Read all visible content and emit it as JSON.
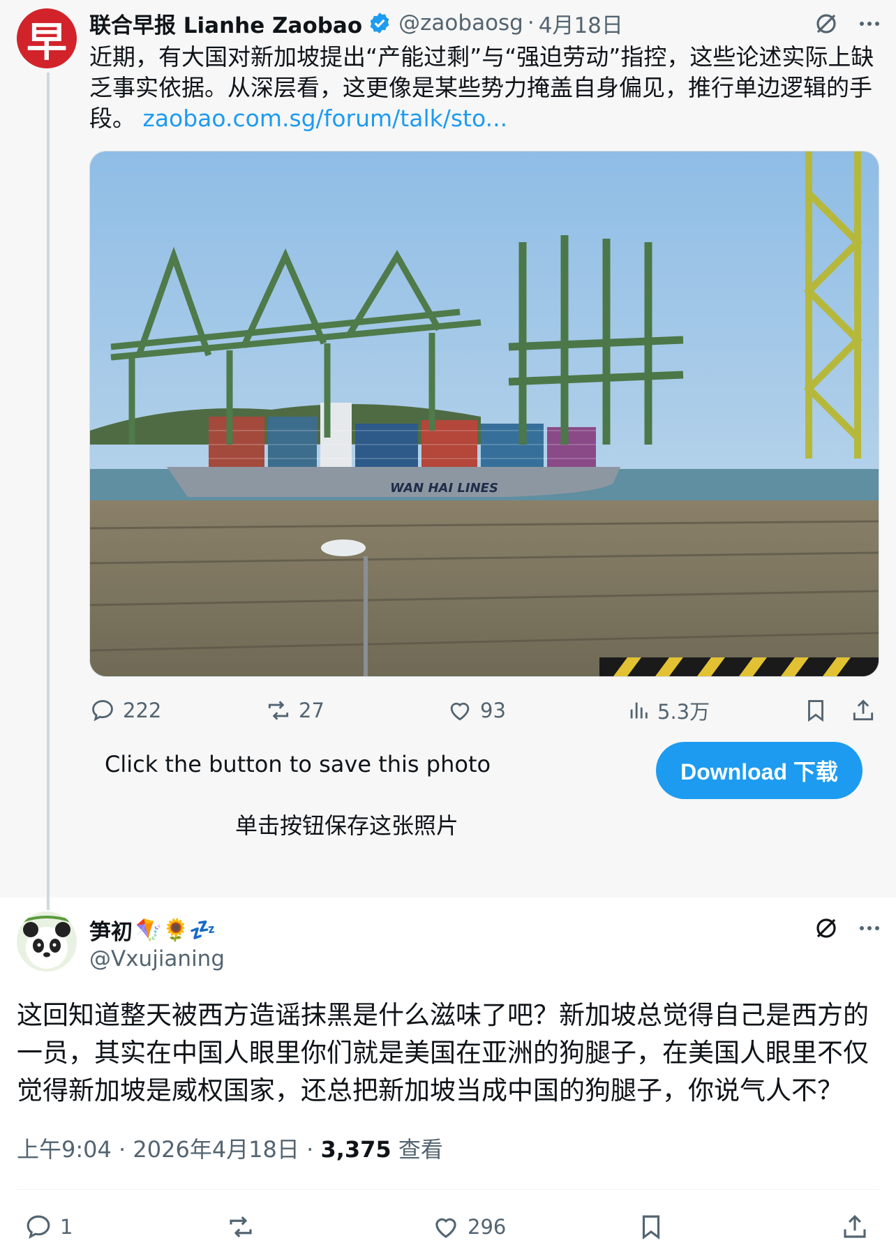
{
  "parent_tweet": {
    "author_name": "联合早报 Lianhe Zaobao",
    "handle": "@zaobaosg",
    "separator": "·",
    "date": "4月18日",
    "avatar_char": "早",
    "text": "近期，有大国对新加坡提出“产能过剩”与“强迫劳动”指控，这些论述实际上缺乏事实依据。从深层看，这更像是某些势力掩盖自身偏见，推行单边逻辑的手段。",
    "link": "zaobao.com.sg/forum/talk/sto...",
    "image_ship_text": "WAN HAI LINES",
    "stats": {
      "replies": "222",
      "reposts": "27",
      "likes": "93",
      "views": "5.3万"
    }
  },
  "save_prompt": {
    "text_en": "Click the button to save this photo",
    "text_cn": "单击按钮保存这张照片",
    "button_label": "Download 下载"
  },
  "reply_tweet": {
    "author_name": "笋初",
    "name_emojis": "🪁🌻💤",
    "handle": "@Vxujianing",
    "text": "这回知道整天被西方造谣抹黑是什么滋味了吧？新加坡总觉得自己是西方的一员，其实在中国人眼里你们就是美国在亚洲的狗腿子，在美国人眼里不仅觉得新加坡是威权国家，还总把新加坡当成中国的狗腿子，你说气人不？",
    "time": "上午9:04",
    "separator": "·",
    "date": "2026年4月18日",
    "views_count": "3,375",
    "views_label": "查看",
    "stats": {
      "replies": "1",
      "reposts": "",
      "likes": "296"
    }
  },
  "colors": {
    "accent": "#1d9bf0",
    "zaobao_red": "#d2232a",
    "text_secondary": "#536471"
  }
}
